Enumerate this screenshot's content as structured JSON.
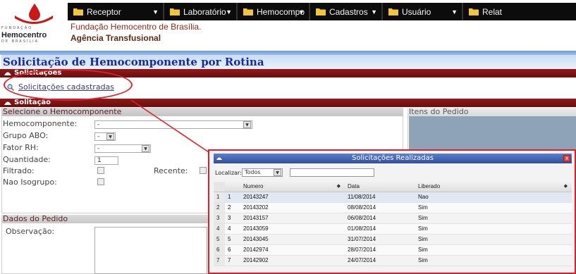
{
  "logo": {
    "line_top": "FUNDAÇÃO",
    "name": "Hemocentro",
    "line_bottom": "DE BRASÍLIA"
  },
  "menu": [
    {
      "label": "Receptor"
    },
    {
      "label": "Laboratório"
    },
    {
      "label": "Hemocompo"
    },
    {
      "label": "Cadastros"
    },
    {
      "label": "Usuário"
    },
    {
      "label": "Relat"
    }
  ],
  "header": {
    "institution": "Fundação Hemocentro de Brasília.",
    "unit": "Agência Transfusional"
  },
  "page_title": "Solicitação de Hemocomponente por Rotina",
  "solicitacoes": {
    "title": "Solicitações",
    "link": "Solicitações cadastradas"
  },
  "solicitacao": {
    "title": "Solitação",
    "select_title": "Selecione o Hemocomponente",
    "items_title": "Itens do Pedido",
    "fields": {
      "hemocomponente_label": "Hemocomponente:",
      "hemocomponente_value": "-",
      "grupo_label": "Grupo ABO:",
      "grupo_value": "-",
      "fator_label": "Fator RH:",
      "fator_value": "-",
      "quantidade_label": "Quantidade:",
      "quantidade_value": "1",
      "filtrado_label": "Filtrado:",
      "recente_label": "Recente:",
      "nao_isogrupo_label": "Nao Isogrupo:"
    },
    "dados_title": "Dados do Pedido",
    "observacao_label": "Observação:"
  },
  "popup": {
    "title": "Solicitações Realizadas",
    "close_glyph": "x",
    "search_label": "Localizar:",
    "search_option": "Todos",
    "columns": [
      "Numero",
      "Data",
      "Liberado"
    ],
    "rows": [
      {
        "n": "1",
        "idx": "1",
        "numero": "20143247",
        "data": "11/08/2014",
        "liberado": "Nao"
      },
      {
        "n": "2",
        "idx": "2",
        "numero": "20143202",
        "data": "08/08/2014",
        "liberado": "Sim"
      },
      {
        "n": "3",
        "idx": "3",
        "numero": "20143157",
        "data": "06/08/2014",
        "liberado": "Sim"
      },
      {
        "n": "4",
        "idx": "4",
        "numero": "20143059",
        "data": "01/08/2014",
        "liberado": "Sim"
      },
      {
        "n": "5",
        "idx": "5",
        "numero": "20143045",
        "data": "31/07/2014",
        "liberado": "Sim"
      },
      {
        "n": "6",
        "idx": "6",
        "numero": "20142974",
        "data": "28/07/2014",
        "liberado": "Sim"
      },
      {
        "n": "7",
        "idx": "7",
        "numero": "20142902",
        "data": "24/07/2014",
        "liberado": "Sim"
      }
    ]
  },
  "colors": {
    "menubar": "#0c0c0c",
    "section_bar": "#7a1212",
    "title_blue": "#1a2a9c",
    "annotation_red": "#e0202a"
  }
}
